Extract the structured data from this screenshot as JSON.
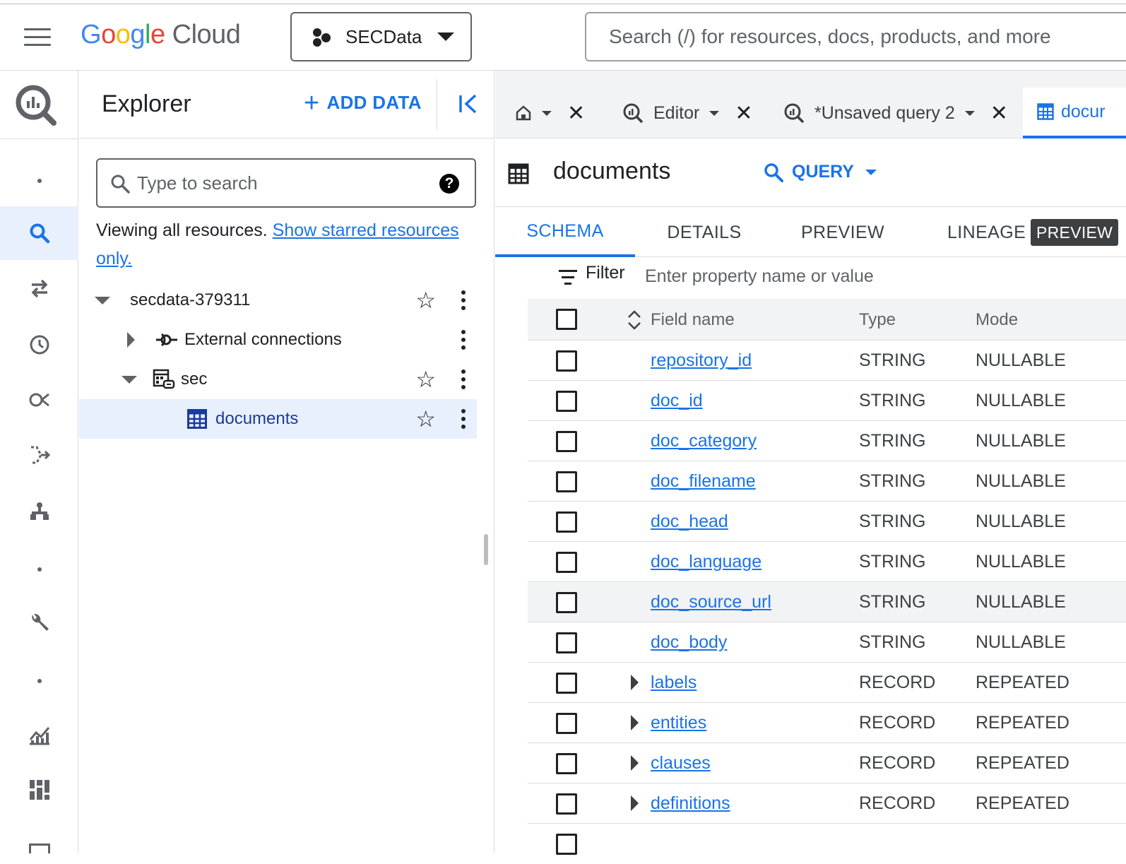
{
  "topbar": {
    "brand_google": "Google",
    "brand_cloud": "Cloud",
    "project_name": "SECData",
    "search_placeholder": "Search (/) for resources, docs, products, and more"
  },
  "explorer": {
    "title": "Explorer",
    "add_data_label": "ADD DATA",
    "search_placeholder": "Type to search",
    "viewing_text": "Viewing all resources.",
    "starred_link": "Show starred resources only.",
    "tree": [
      {
        "label": "secdata-379311",
        "icon": "project",
        "starred": true
      },
      {
        "label": "External connections",
        "icon": "connection-icon",
        "starred": false
      },
      {
        "label": "sec",
        "icon": "dataset-icon",
        "starred": true
      },
      {
        "label": "documents",
        "icon": "table-icon",
        "starred": true,
        "selected": true
      }
    ]
  },
  "tabs": [
    {
      "label": "",
      "icon": "home-icon"
    },
    {
      "label": "Editor",
      "icon": "query-icon"
    },
    {
      "label": "*Unsaved query 2",
      "icon": "query-icon"
    },
    {
      "label": "docur",
      "icon": "table-icon",
      "active": true
    }
  ],
  "table": {
    "title": "documents",
    "query_label": "QUERY",
    "sub_tabs": [
      "SCHEMA",
      "DETAILS",
      "PREVIEW",
      "LINEAGE"
    ],
    "preview_badge": "PREVIEW",
    "filter_label": "Filter",
    "filter_placeholder": "Enter property name or value",
    "columns": {
      "name": "Field name",
      "type": "Type",
      "mode": "Mode"
    },
    "fields": [
      {
        "name": "repository_id",
        "type": "STRING",
        "mode": "NULLABLE"
      },
      {
        "name": "doc_id",
        "type": "STRING",
        "mode": "NULLABLE"
      },
      {
        "name": "doc_category",
        "type": "STRING",
        "mode": "NULLABLE"
      },
      {
        "name": "doc_filename",
        "type": "STRING",
        "mode": "NULLABLE"
      },
      {
        "name": "doc_head",
        "type": "STRING",
        "mode": "NULLABLE"
      },
      {
        "name": "doc_language",
        "type": "STRING",
        "mode": "NULLABLE"
      },
      {
        "name": "doc_source_url",
        "type": "STRING",
        "mode": "NULLABLE"
      },
      {
        "name": "doc_body",
        "type": "STRING",
        "mode": "NULLABLE"
      },
      {
        "name": "labels",
        "type": "RECORD",
        "mode": "REPEATED"
      },
      {
        "name": "entities",
        "type": "RECORD",
        "mode": "REPEATED"
      },
      {
        "name": "clauses",
        "type": "RECORD",
        "mode": "REPEATED"
      },
      {
        "name": "definitions",
        "type": "RECORD",
        "mode": "REPEATED"
      }
    ]
  },
  "colors": {
    "accent": "#1a73e8",
    "selected_bg": "#e8f0fe",
    "header_bg": "#f1f3f4"
  }
}
